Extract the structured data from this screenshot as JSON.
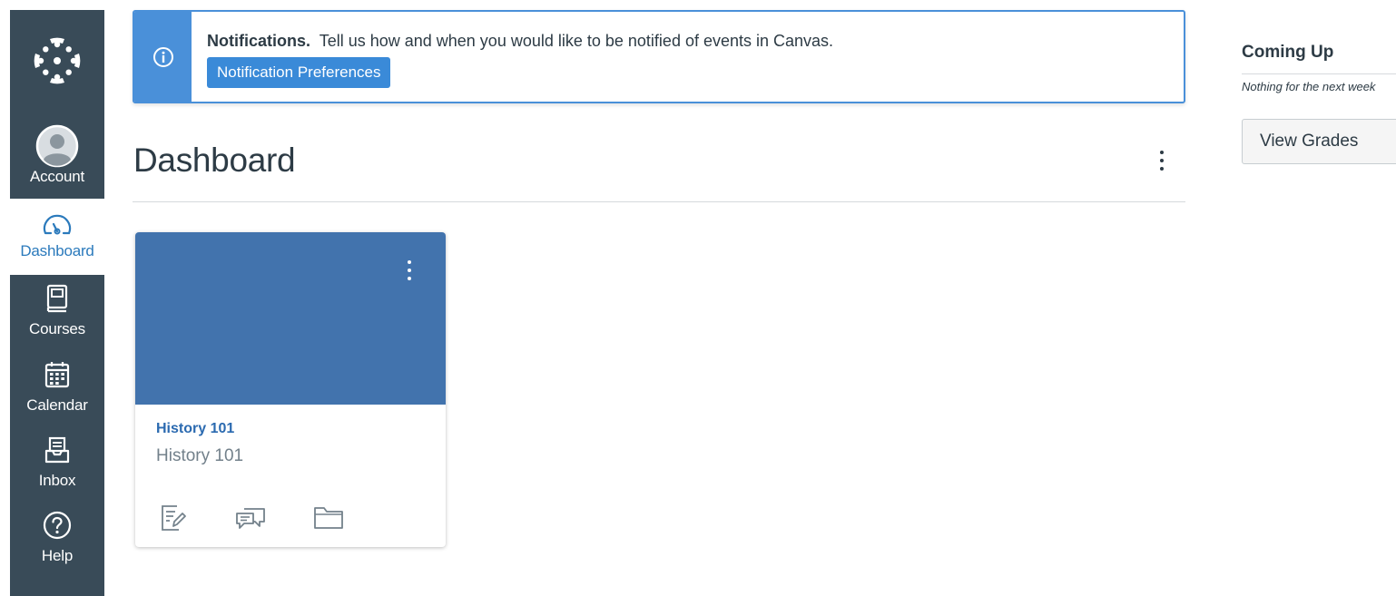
{
  "global_nav": {
    "logo_icon": "canvas-logo-icon",
    "items": [
      {
        "label": "Account",
        "icon": "avatar-icon",
        "active": false
      },
      {
        "label": "Dashboard",
        "icon": "dashboard-gauge-icon",
        "active": true
      },
      {
        "label": "Courses",
        "icon": "book-icon",
        "active": false
      },
      {
        "label": "Calendar",
        "icon": "calendar-icon",
        "active": false
      },
      {
        "label": "Inbox",
        "icon": "inbox-icon",
        "active": false
      },
      {
        "label": "Help",
        "icon": "question-mark-icon",
        "active": false
      }
    ],
    "colors": {
      "background": "#394b58",
      "active_text": "#2b7abc"
    }
  },
  "notification": {
    "icon": "info-icon",
    "title": "Notifications.",
    "message": "Tell us how and when you would like to be notified of events in Canvas.",
    "button_label": "Notification Preferences",
    "accent_color": "#4a90d9"
  },
  "dashboard": {
    "title": "Dashboard",
    "menu_icon": "kebab-menu-icon"
  },
  "course_card": {
    "title": "History 101",
    "subtitle": "History 101",
    "hero_color": "#4273ad",
    "actions": [
      {
        "icon": "assignments-icon"
      },
      {
        "icon": "discussions-icon"
      },
      {
        "icon": "files-folder-icon"
      }
    ]
  },
  "sidebar": {
    "coming_up_title": "Coming Up",
    "nothing_text": "Nothing for the next week",
    "view_grades_label": "View Grades"
  }
}
